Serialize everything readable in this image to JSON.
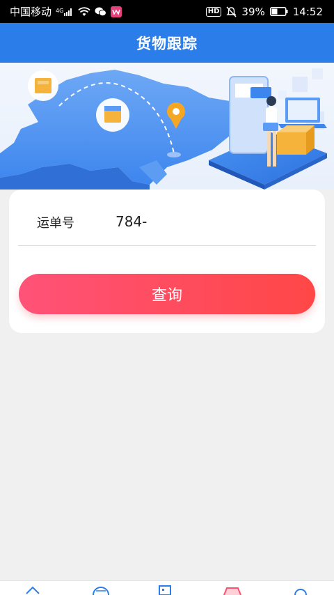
{
  "status_bar": {
    "carrier": "中国移动",
    "network": "4G",
    "battery": "39%",
    "time": "14:52",
    "hd": "HD"
  },
  "header": {
    "title": "货物跟踪"
  },
  "form": {
    "waybill_label": "运单号",
    "waybill_value": "784-",
    "query_button": "查询"
  },
  "colors": {
    "header_bg": "#2b7de9",
    "button_start": "#ff5278",
    "button_end": "#ff4747"
  }
}
